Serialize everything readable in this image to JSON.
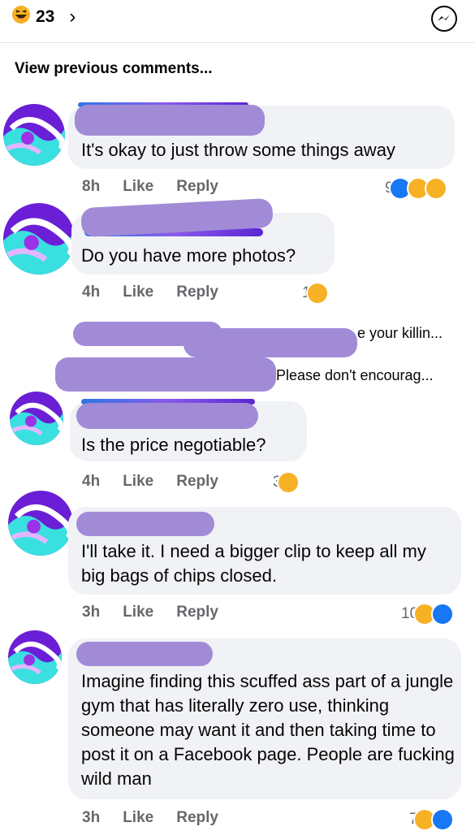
{
  "header": {
    "reaction_count": "23",
    "chevron": "›"
  },
  "view_previous": "View previous comments...",
  "comments": [
    {
      "text": "It's okay to just throw some things away",
      "time": "8h",
      "like": "Like",
      "reply": "Reply",
      "reaction_count": "9",
      "reactions": [
        "like",
        "haha",
        "care"
      ]
    },
    {
      "text": "Do you have more photos?",
      "time": "4h",
      "like": "Like",
      "reply": "Reply",
      "reaction_count": "1",
      "reactions": [
        "haha"
      ]
    },
    {
      "text": "Is the price negotiable?",
      "time": "4h",
      "like": "Like",
      "reply": "Reply",
      "reaction_count": "3",
      "reactions": [
        "haha"
      ]
    },
    {
      "text": "I'll take it. I need a bigger clip to keep all my big bags of chips closed.",
      "time": "3h",
      "like": "Like",
      "reply": "Reply",
      "reaction_count": "10",
      "reactions": [
        "haha",
        "like"
      ]
    },
    {
      "text": "Imagine finding this scuffed ass part of a jungle gym that has literally zero use, thinking someone may want it and then taking time to post it on a Facebook page. People are fucking wild man",
      "time": "3h",
      "like": "Like",
      "reply": "Reply",
      "reaction_count": "7",
      "reactions": [
        "haha",
        "like"
      ]
    }
  ],
  "replies": [
    {
      "text": "e your killin..."
    },
    {
      "text": "Please don't encourag..."
    }
  ],
  "colors": {
    "like": "#1877f2",
    "haha": "#f7b125",
    "bubble": "#f0f2f5",
    "redaction": "#a18bd6",
    "meta": "#65676b"
  },
  "icons": {
    "header_reaction": "haha-emoji-icon",
    "messenger": "messenger-icon"
  }
}
